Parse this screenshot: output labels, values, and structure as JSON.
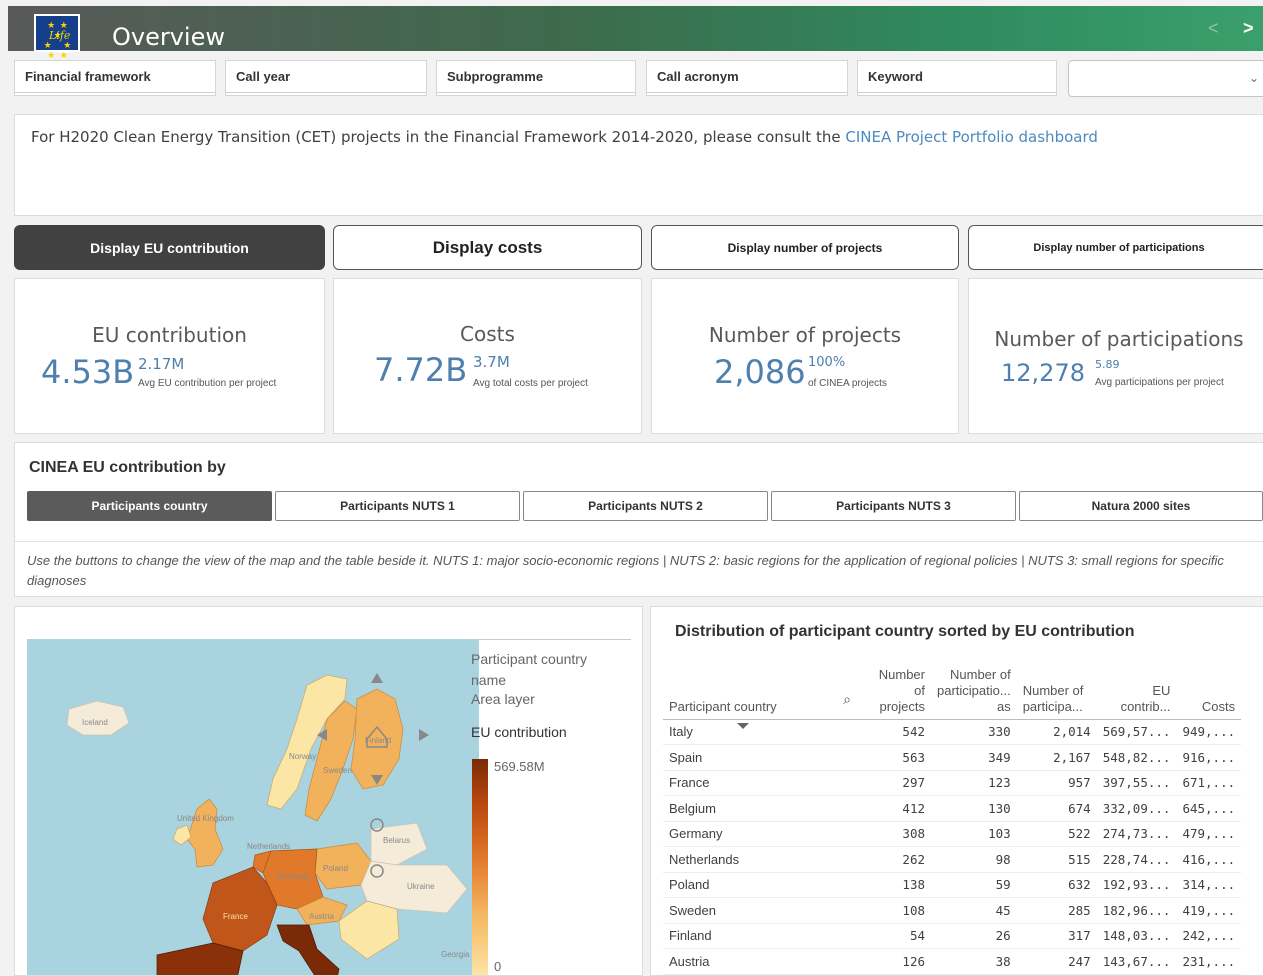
{
  "header": {
    "title": "Overview",
    "logo_text": "Life"
  },
  "filters": [
    "Financial framework",
    "Call year",
    "Subprogramme",
    "Call acronym",
    "Keyword"
  ],
  "notice": {
    "text": "For H2020 Clean Energy Transition (CET) projects in the Financial Framework 2014-2020, please consult the ",
    "link": "CINEA Project Portfolio dashboard"
  },
  "display_buttons": [
    "Display EU contribution",
    "Display costs",
    "Display number of projects",
    "Display number of participations"
  ],
  "kpis": [
    {
      "title": "EU contribution",
      "value": "4.53B",
      "sup": "2.17M",
      "sub": "Avg EU contribution per project"
    },
    {
      "title": "Costs",
      "value": "7.72B",
      "sup": "3.7M",
      "sub": "Avg total costs per project"
    },
    {
      "title": "Number of projects",
      "value": "2,086",
      "sup": "100%",
      "sub": "of CINEA projects"
    },
    {
      "title": "Number of participations",
      "value": "12,278",
      "sup": "5.89",
      "sub": "Avg participations per project"
    }
  ],
  "section": {
    "title": "CINEA EU contribution by",
    "segments": [
      "Participants country",
      "Participants NUTS 1",
      "Participants NUTS 2",
      "Participants NUTS 3",
      "Natura 2000 sites"
    ],
    "note": "Use the buttons to change the view of the map and the table beside it. NUTS 1: major socio-economic regions | NUTS 2: basic regions for the application of regional policies | NUTS 3: small regions for specific diagnoses"
  },
  "map": {
    "legend_layer": "Participant country name",
    "legend_area": "Area layer",
    "legend_measure": "EU contribution",
    "legend_max": "569.58M",
    "legend_min": "0",
    "labels": [
      "Iceland",
      "Finland",
      "Sweden",
      "Norway",
      "United Kingdom",
      "Netherlands",
      "Germany",
      "Poland",
      "France",
      "Ukraine",
      "Belarus",
      "Georgia",
      "Austria"
    ],
    "colors": {
      "sea": "#a9d3de",
      "land_other": "#f4ecd8",
      "low": "#fbe6a6",
      "mid": "#f2b25c",
      "high": "#e07a2a",
      "top": "#8b310a"
    }
  },
  "table": {
    "title": "Distribution of participant country sorted by EU contribution",
    "headers": [
      "Participant country",
      "Number of projects",
      "Number of participatio... as",
      "Number of participa...",
      "EU contrib...",
      "Costs"
    ],
    "rows": [
      [
        "Italy",
        "542",
        "330",
        "2,014",
        "569,57...",
        "949,..."
      ],
      [
        "Spain",
        "563",
        "349",
        "2,167",
        "548,82...",
        "916,..."
      ],
      [
        "France",
        "297",
        "123",
        "957",
        "397,55...",
        "671,..."
      ],
      [
        "Belgium",
        "412",
        "130",
        "674",
        "332,09...",
        "645,..."
      ],
      [
        "Germany",
        "308",
        "103",
        "522",
        "274,73...",
        "479,..."
      ],
      [
        "Netherlands",
        "262",
        "98",
        "515",
        "228,74...",
        "416,..."
      ],
      [
        "Poland",
        "138",
        "59",
        "632",
        "192,93...",
        "314,..."
      ],
      [
        "Sweden",
        "108",
        "45",
        "285",
        "182,96...",
        "419,..."
      ],
      [
        "Finland",
        "54",
        "26",
        "317",
        "148,03...",
        "242,..."
      ],
      [
        "Austria",
        "126",
        "38",
        "247",
        "143,67...",
        "231,..."
      ]
    ]
  }
}
